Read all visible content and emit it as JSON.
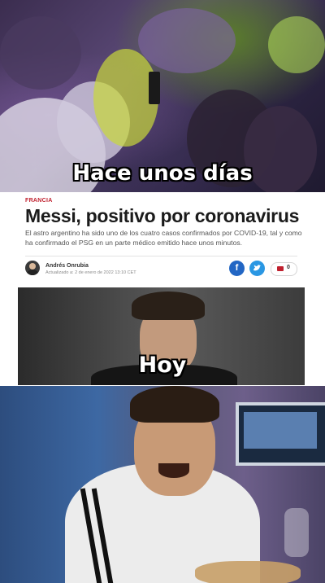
{
  "panel1": {
    "caption": "Hace unos días"
  },
  "article": {
    "section": "FRANCIA",
    "headline": "Messi, positivo por coronavirus",
    "lead": "El astro argentino ha sido uno de los cuatro casos confirmados por COVID-19, tal y como ha confirmado el PSG en un parte médico emitido hace unos minutos.",
    "author": "Andrés Onrubia",
    "updated": "Actualizado a: 2 de enero de 2022 13:10 CET",
    "comment_count": "0",
    "share_icons": [
      "facebook-icon",
      "twitter-icon",
      "comment-icon"
    ],
    "colors": {
      "section": "#c0202e",
      "facebook": "#2266c4",
      "twitter": "#2a97e3"
    }
  },
  "panel3": {
    "caption": "Hoy"
  }
}
